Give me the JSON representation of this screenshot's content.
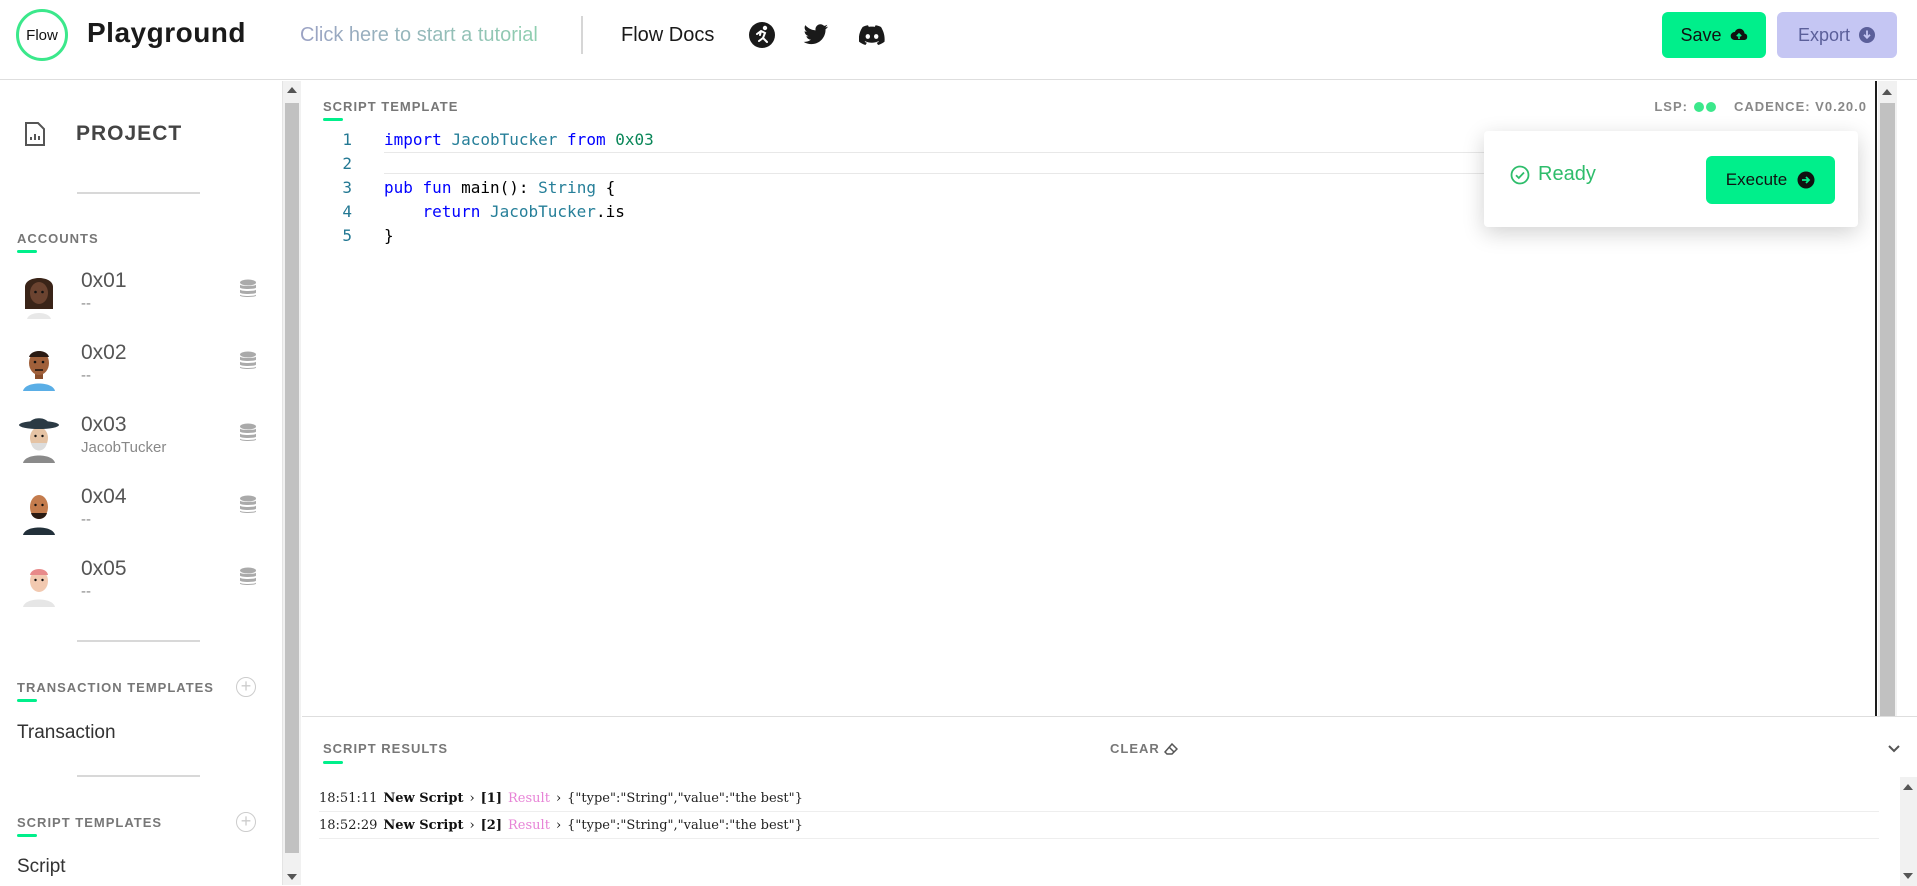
{
  "header": {
    "logo_text": "Flow",
    "title": "Playground",
    "tutorial_link": "Click here to start a tutorial",
    "docs_link": "Flow Docs",
    "icons": [
      "flow-runner-icon",
      "twitter-icon",
      "discord-icon"
    ],
    "save_label": "Save",
    "export_label": "Export"
  },
  "sidebar": {
    "project_label": "PROJECT",
    "accounts_label": "ACCOUNTS",
    "accounts": [
      {
        "address": "0x01",
        "contract": "--"
      },
      {
        "address": "0x02",
        "contract": "--"
      },
      {
        "address": "0x03",
        "contract": "JacobTucker"
      },
      {
        "address": "0x04",
        "contract": "--"
      },
      {
        "address": "0x05",
        "contract": "--"
      }
    ],
    "transaction_templates_label": "TRANSACTION TEMPLATES",
    "transactions": [
      "Transaction"
    ],
    "script_templates_label": "SCRIPT TEMPLATES",
    "scripts": [
      "Script"
    ]
  },
  "editor": {
    "title": "SCRIPT TEMPLATE",
    "lsp_label": "LSP:",
    "cadence_version": "CADENCE: V0.20.0",
    "line_numbers": [
      "1",
      "2",
      "3",
      "4",
      "5"
    ],
    "active_line": 2
  },
  "execute": {
    "status": "Ready",
    "button_label": "Execute"
  },
  "results": {
    "title": "SCRIPT RESULTS",
    "clear_label": "CLEAR",
    "entries": [
      {
        "time": "18:51:11",
        "label": "New Script",
        "index": "[1]",
        "kind": "Result",
        "value": "{\"type\":\"String\",\"value\":\"the best\"}"
      },
      {
        "time": "18:52:29",
        "label": "New Script",
        "index": "[2]",
        "kind": "Result",
        "value": "{\"type\":\"String\",\"value\":\"the best\"}"
      }
    ]
  },
  "colors": {
    "accent": "#00ef8b",
    "export_bg": "#c5c6f3",
    "ready": "#2ebd6b"
  }
}
